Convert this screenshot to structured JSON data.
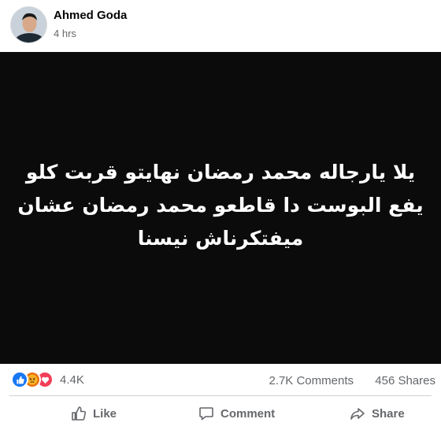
{
  "post": {
    "author": "Ahmed Goda",
    "time": "4 hrs",
    "image_text": "يلا يارجاله محمد رمضان نهايتو قربت كلو يفع البوست دا قاطعو محمد رمضان عشان ميفتكرناش نيسنا"
  },
  "stats": {
    "reactions": [
      "like-icon",
      "angry-icon",
      "love-icon"
    ],
    "reaction_count": "4.4K",
    "comments": "2.7K Comments",
    "shares": "456 Shares"
  },
  "actions": {
    "like": "Like",
    "comment": "Comment",
    "share": "Share"
  },
  "colors": {
    "like_blue": "#1877f2",
    "angry_orange": "#e9710f",
    "love_red": "#f33e58",
    "muted_text": "#65676b"
  }
}
